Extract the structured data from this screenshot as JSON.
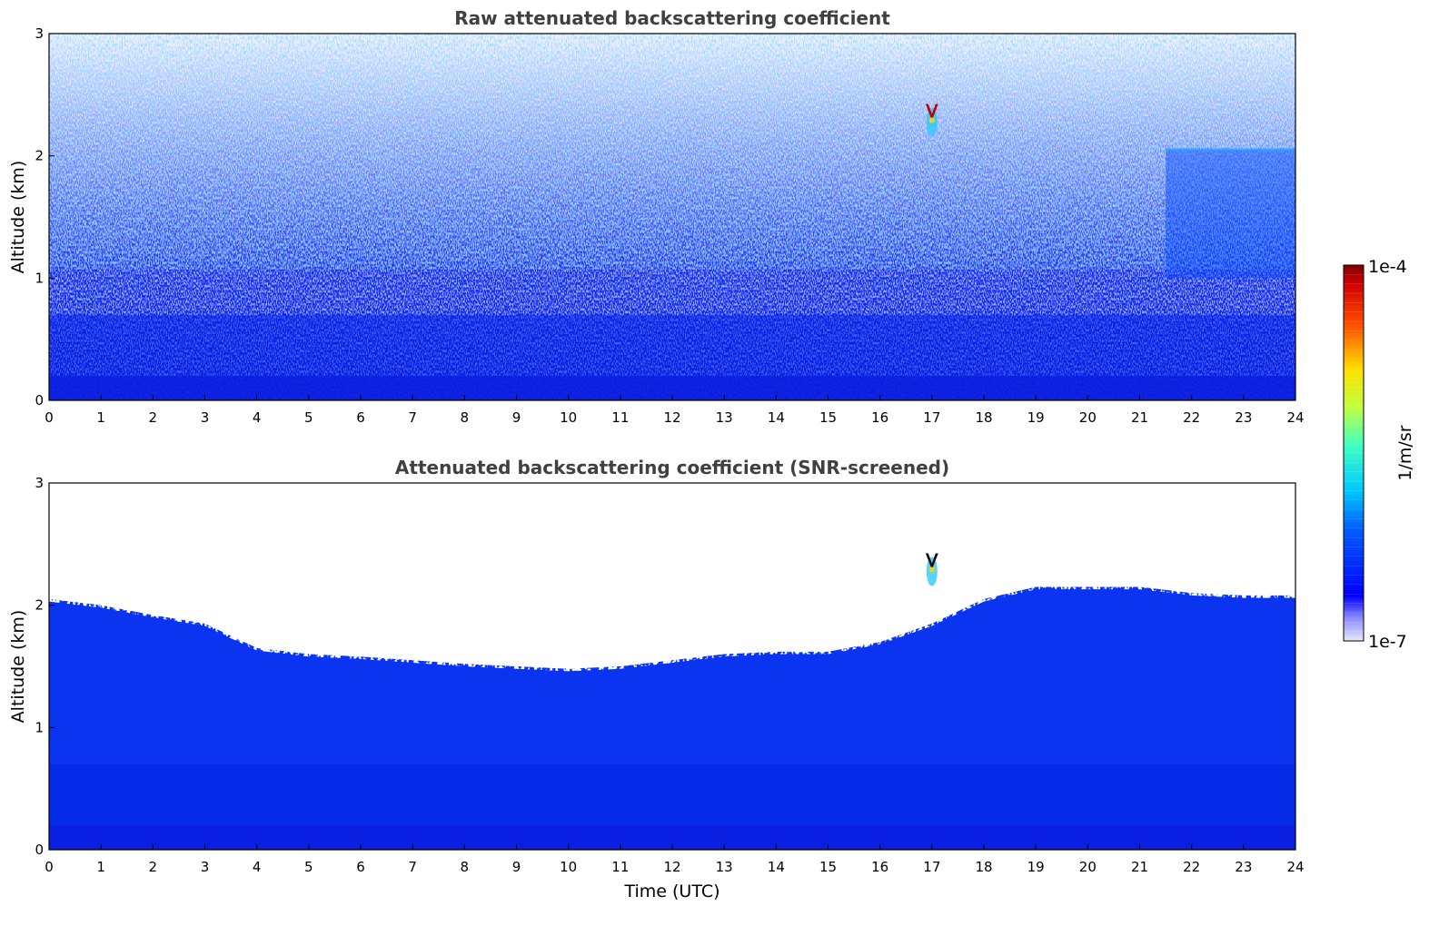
{
  "chart_data": [
    {
      "type": "heatmap",
      "title": "Raw attenuated backscattering coefficient",
      "xlabel": "",
      "ylabel": "Altitude (km)",
      "xlim": [
        0,
        24
      ],
      "ylim": [
        0,
        3
      ],
      "x_ticks": [
        "0",
        "1",
        "2",
        "3",
        "4",
        "5",
        "6",
        "7",
        "8",
        "9",
        "10",
        "11",
        "12",
        "13",
        "14",
        "15",
        "16",
        "17",
        "18",
        "19",
        "20",
        "21",
        "22",
        "23",
        "24"
      ],
      "y_ticks": [
        "0",
        "1",
        "2",
        "3"
      ],
      "scale": "log",
      "features": [
        {
          "kind": "noisy-signal",
          "altitude_km": [
            1.0,
            3.0
          ],
          "description_value": "sparse"
        },
        {
          "kind": "boundary-layer",
          "altitude_km": [
            0.0,
            0.7
          ]
        },
        {
          "kind": "aerosol-layer-top",
          "time_utc": [
            21.5,
            24
          ],
          "altitude_km": 2.05
        },
        {
          "kind": "cloud",
          "time_utc": 17.0,
          "altitude_km": 2.35
        }
      ]
    },
    {
      "type": "heatmap",
      "title": "Attenuated backscattering coefficient (SNR-screened)",
      "xlabel": "Time (UTC)",
      "ylabel": "Altitude (km)",
      "xlim": [
        0,
        24
      ],
      "ylim": [
        0,
        3
      ],
      "x_ticks": [
        "0",
        "1",
        "2",
        "3",
        "4",
        "5",
        "6",
        "7",
        "8",
        "9",
        "10",
        "11",
        "12",
        "13",
        "14",
        "15",
        "16",
        "17",
        "18",
        "19",
        "20",
        "21",
        "22",
        "23",
        "24"
      ],
      "y_ticks": [
        "0",
        "1",
        "2",
        "3"
      ],
      "scale": "log",
      "layer_top_km": {
        "time_utc": [
          0,
          1,
          2,
          3,
          4,
          5,
          6,
          7,
          8,
          9,
          10,
          11,
          12,
          13,
          14,
          15,
          16,
          17,
          18,
          19,
          20,
          21,
          22,
          23,
          24
        ],
        "altitude_km": [
          2.05,
          2.0,
          1.92,
          1.85,
          1.65,
          1.6,
          1.58,
          1.55,
          1.52,
          1.5,
          1.48,
          1.5,
          1.55,
          1.6,
          1.62,
          1.62,
          1.7,
          1.85,
          2.05,
          2.15,
          2.15,
          2.15,
          2.1,
          2.08,
          2.08
        ]
      },
      "features": [
        {
          "kind": "cloud",
          "time_utc": 17.0,
          "altitude_km": 2.35
        }
      ]
    }
  ],
  "colorbar": {
    "max_label": "1e-4",
    "min_label": "1e-7",
    "unit_label": "1/m/sr",
    "colormap": "jet"
  }
}
